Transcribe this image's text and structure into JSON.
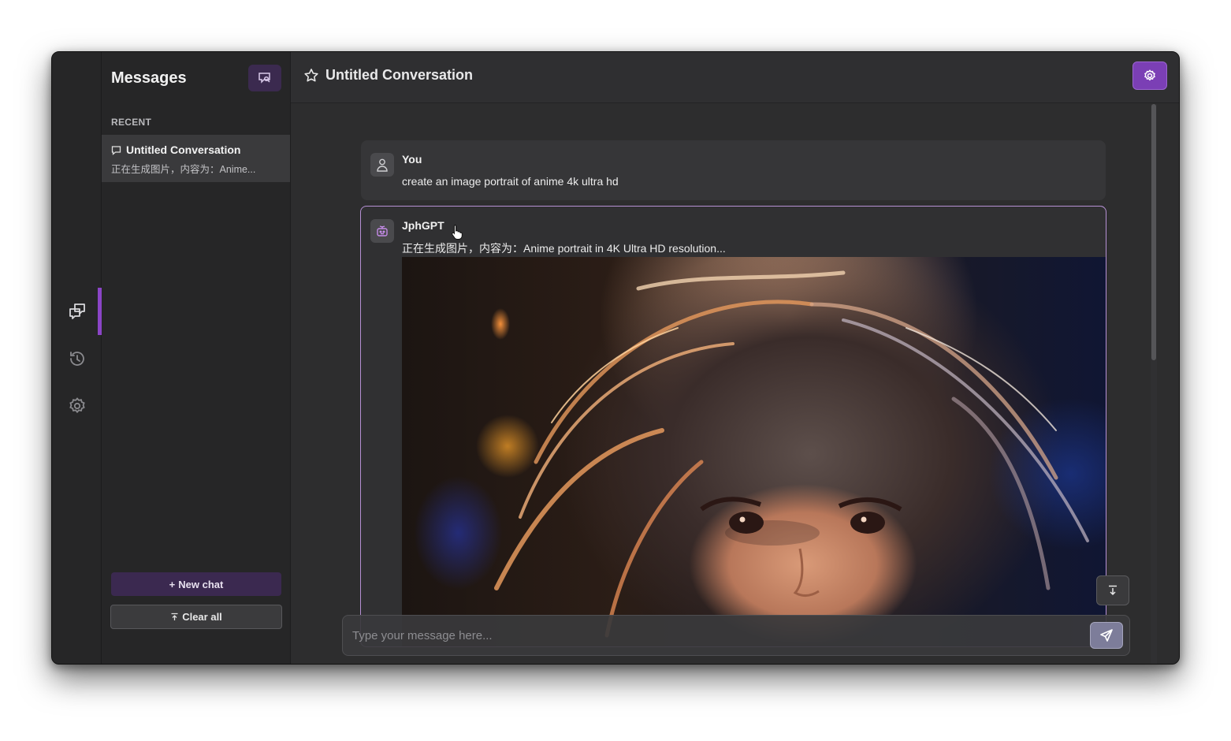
{
  "sidebar": {
    "title": "Messages",
    "recent_label": "RECENT",
    "conversations": [
      {
        "title": "Untitled Conversation",
        "preview": "正在生成图片，内容为：Anime..."
      }
    ],
    "new_chat_label": "New chat",
    "clear_all_label": "Clear all"
  },
  "rail": {
    "items": [
      "chats-icon",
      "history-icon",
      "settings-icon"
    ],
    "active": "chats-icon"
  },
  "header": {
    "title": "Untitled Conversation"
  },
  "messages": [
    {
      "sender": "You",
      "text": "create an image portrait of anime 4k ultra hd"
    },
    {
      "sender": "JphGPT",
      "text": "正在生成图片，内容为：Anime portrait in 4K Ultra HD resolution..."
    }
  ],
  "composer": {
    "placeholder": "Type your message here...",
    "value": ""
  },
  "colors": {
    "accent": "#7b3fb5",
    "accent_dark": "#3b2950",
    "selected_border": "#b690d4",
    "background": "#2d2d2e"
  }
}
